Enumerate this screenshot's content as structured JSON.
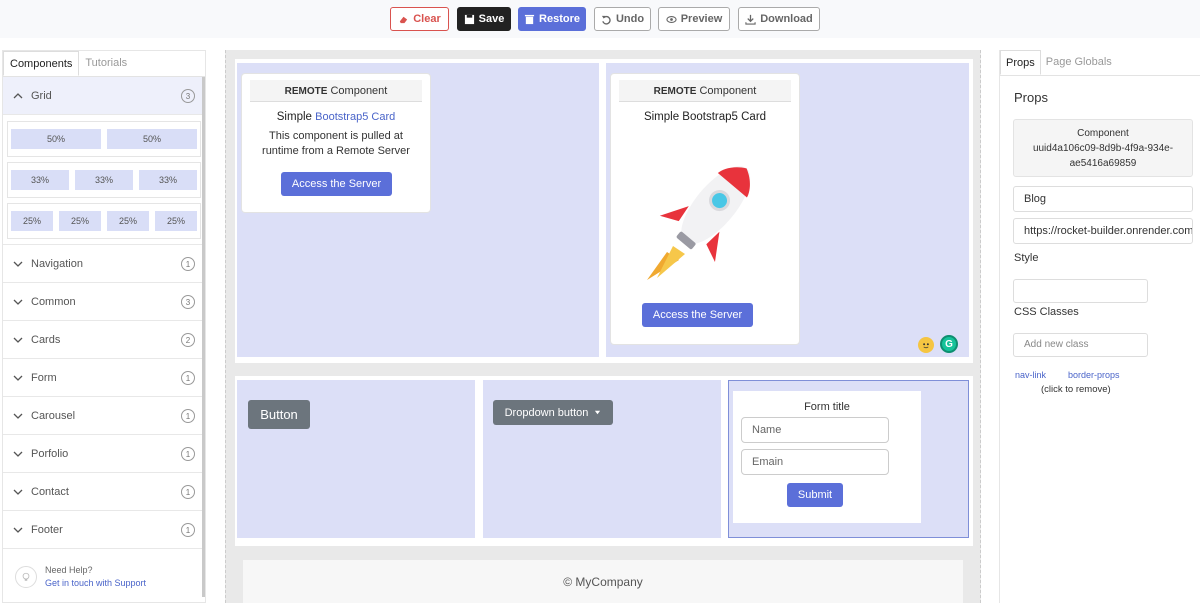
{
  "toolbar": {
    "clear": "Clear",
    "save": "Save",
    "restore": "Restore",
    "undo": "Undo",
    "preview": "Preview",
    "download": "Download"
  },
  "left": {
    "tabs": [
      "Components",
      "Tutorials"
    ],
    "grid": {
      "label": "Grid",
      "count": "3",
      "rows": [
        [
          "50%",
          "50%"
        ],
        [
          "33%",
          "33%",
          "33%"
        ],
        [
          "25%",
          "25%",
          "25%",
          "25%"
        ]
      ]
    },
    "groups": [
      {
        "label": "Navigation",
        "count": "1"
      },
      {
        "label": "Common",
        "count": "3"
      },
      {
        "label": "Cards",
        "count": "2"
      },
      {
        "label": "Form",
        "count": "1"
      },
      {
        "label": "Carousel",
        "count": "1"
      },
      {
        "label": "Porfolio",
        "count": "1"
      },
      {
        "label": "Contact",
        "count": "1"
      },
      {
        "label": "Footer",
        "count": "1"
      }
    ],
    "help_title": "Need Help?",
    "help_link": "Get in touch with Support"
  },
  "canvas": {
    "card1": {
      "head_bold": "REMOTE",
      "head_rest": " Component",
      "title_plain": "Simple ",
      "title_link": "Bootstrap5 Card",
      "text": "This component is pulled at runtime from a Remote Server",
      "button": "Access the Server"
    },
    "card2": {
      "head_bold": "REMOTE",
      "head_rest": " Component",
      "title": "Simple Bootstrap5 Card",
      "button": "Access the Server"
    },
    "grammarly": "G",
    "button": "Button",
    "dropdown": "Dropdown button",
    "form": {
      "title": "Form title",
      "name_placeholder": "Name",
      "email_placeholder": "Emain",
      "submit": "Submit"
    },
    "footer": "© MyCompany"
  },
  "right": {
    "tabs": [
      "Props",
      "Page Globals"
    ],
    "props_title": "Props",
    "component_label": "Component",
    "component_id": "uuid4a106c09-8d9b-4f9a-934e-ae5416a69859",
    "blog_value": "Blog",
    "url_value": "https://rocket-builder.onrender.com",
    "style_label": "Style",
    "css_label": "CSS Classes",
    "css_placeholder": "Add new class",
    "tags": [
      "nav-link",
      "border-props"
    ],
    "remove_note": "(click to remove)"
  },
  "colors": {
    "primary": "#5b6fd9",
    "danger": "#d9534f",
    "dark": "#222222",
    "secondary": "#6c757d",
    "column": "#dcdff7"
  }
}
